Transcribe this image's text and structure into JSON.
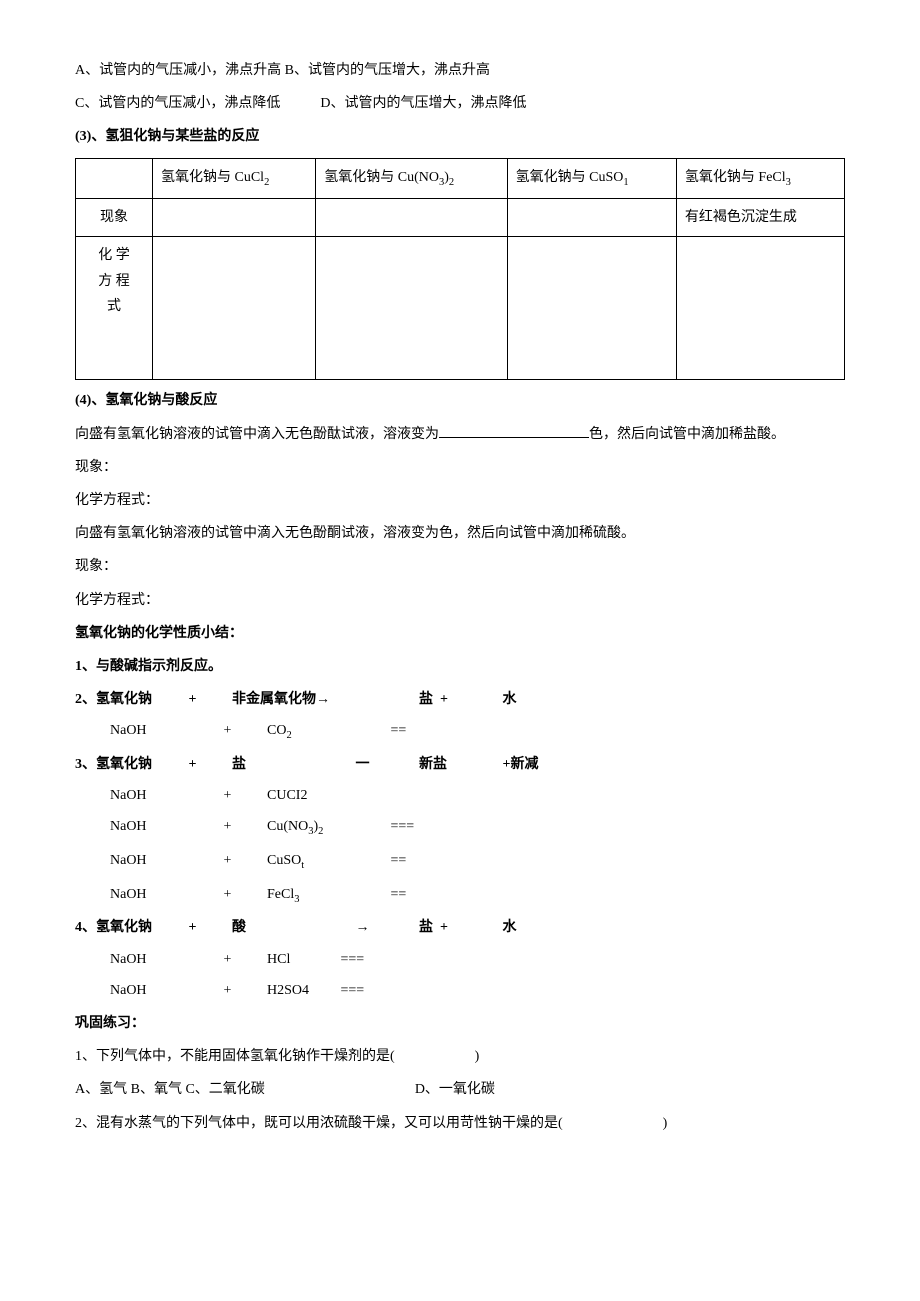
{
  "options": {
    "a": "A、试管内的气压减小，沸点升高",
    "b": "B、试管内的气压增大，沸点升高",
    "c": "C、试管内的气压减小，沸点降低",
    "d": "D、试管内的气压增大，沸点降低"
  },
  "section3": {
    "title": "(3)、氢狙化钠与某些盐的反应",
    "headers": {
      "h1": "氢氧化钠与 CuCl",
      "h2": "氢氧化钠与 Cu(NO",
      "h2b": ")",
      "h3": "氢氧化钠与 CuSO",
      "h4": "氢氧化钠与 FeCl"
    },
    "row1": "现象",
    "row1_val4": "有红褐色沉淀生成",
    "row2a": "化 学",
    "row2b": "方 程",
    "row2c": "式"
  },
  "section4": {
    "title": "(4)、氢氧化钠与酸反应",
    "line1a": "向盛有氢氧化钠溶液的试管中滴入无色酚酞试液，溶液变为",
    "line1b": "色，然后向试管中滴加稀盐酸。",
    "line2": "现象：",
    "line3": "化学方程式：",
    "line4": "向盛有氢氧化钠溶液的试管中滴入无色酚酮试液，溶液变为色，然后向试管中滴加稀硫酸。",
    "line5": "现象：",
    "line6": "化学方程式："
  },
  "summary": {
    "title": "氢氧化钠的化学性质小结：",
    "item1": "1、与酸碱指示剂反应。",
    "item2": {
      "label": "2、氢氧化钠",
      "plus": "+",
      "c": "非金属氧化物→",
      "e": "盐",
      "plus2": "+",
      "f": "水",
      "sub_a": "NaOH",
      "sub_c": "CO",
      "sub_d": "=="
    },
    "item3": {
      "label": "3、氢氧化钠",
      "plus": "+",
      "c": "盐",
      "d": "一",
      "e": "新盐",
      "f": "+新减",
      "r1_a": "NaOH",
      "r1_c": "CUCI2",
      "r2_a": "NaOH",
      "r2_c": "Cu(NO",
      "r2_c2": ")",
      "r2_d": "===",
      "r3_a": "NaOH",
      "r3_c": "CuSO",
      "r3_d": "==",
      "r4_a": "NaOH",
      "r4_c": "FeCl",
      "r4_d": "=="
    },
    "item4": {
      "label": "4、氢氧化钠",
      "plus": "+",
      "c": "酸",
      "d": "→",
      "e": "盐",
      "plus2": "+",
      "f": "水",
      "r1_a": "NaOH",
      "r1_c": "HCl",
      "r1_d": "===",
      "r2_a": "NaOH",
      "r2_c": "H2SO4",
      "r2_d": "==="
    }
  },
  "practice": {
    "title": "巩固练习：",
    "q1": "1、下列气体中，不能用固体氢氧化钠作干燥剂的是(",
    "q1_close": ")",
    "q1_a": "A、氢气",
    "q1_b": "B、氧气",
    "q1_c": "C、二氧化碳",
    "q1_d": "D、一氧化碳",
    "q2": "2、混有水蒸气的下列气体中，既可以用浓硫酸干燥，又可以用苛性钠干燥的是(",
    "q2_close": ")"
  }
}
